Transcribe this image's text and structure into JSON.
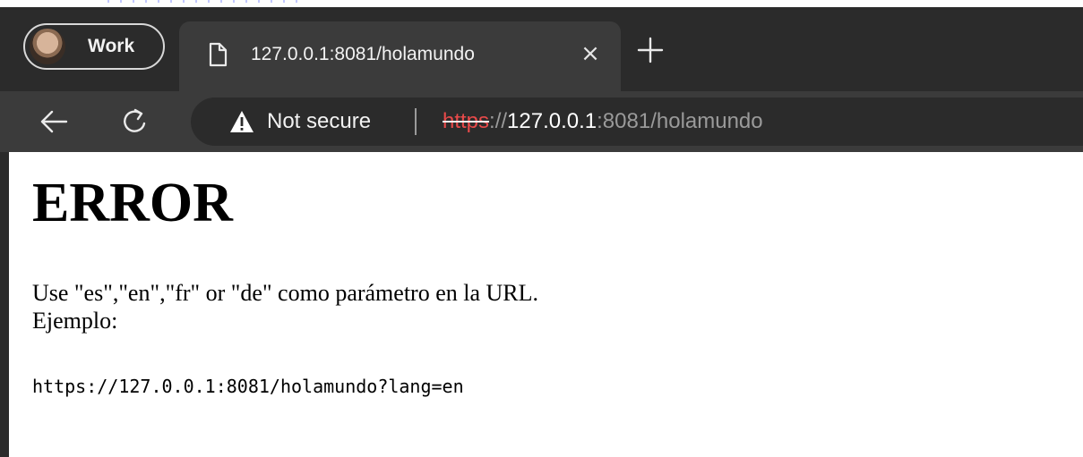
{
  "browser": {
    "profile_label": "Work",
    "tab": {
      "title": "127.0.0.1:8081/holamundo",
      "close_glyph": "×"
    },
    "new_tab_icon": "plus-icon",
    "omnibox": {
      "security_label": "Not secure",
      "url_scheme": "https",
      "url_separator": "://",
      "url_host": "127.0.0.1",
      "url_rest": ":8081/holamundo"
    },
    "colors": {
      "chrome_dark": "#2b2b2b",
      "chrome_mid": "#3b3b3b",
      "insecure_red": "#e84a4a"
    }
  },
  "page": {
    "heading": "ERROR",
    "line1": "Use \"es\",\"en\",\"fr\" or \"de\" como parámetro en la URL.",
    "line2": "Ejemplo:",
    "example_url": "https://127.0.0.1:8081/holamundo?lang=en"
  }
}
